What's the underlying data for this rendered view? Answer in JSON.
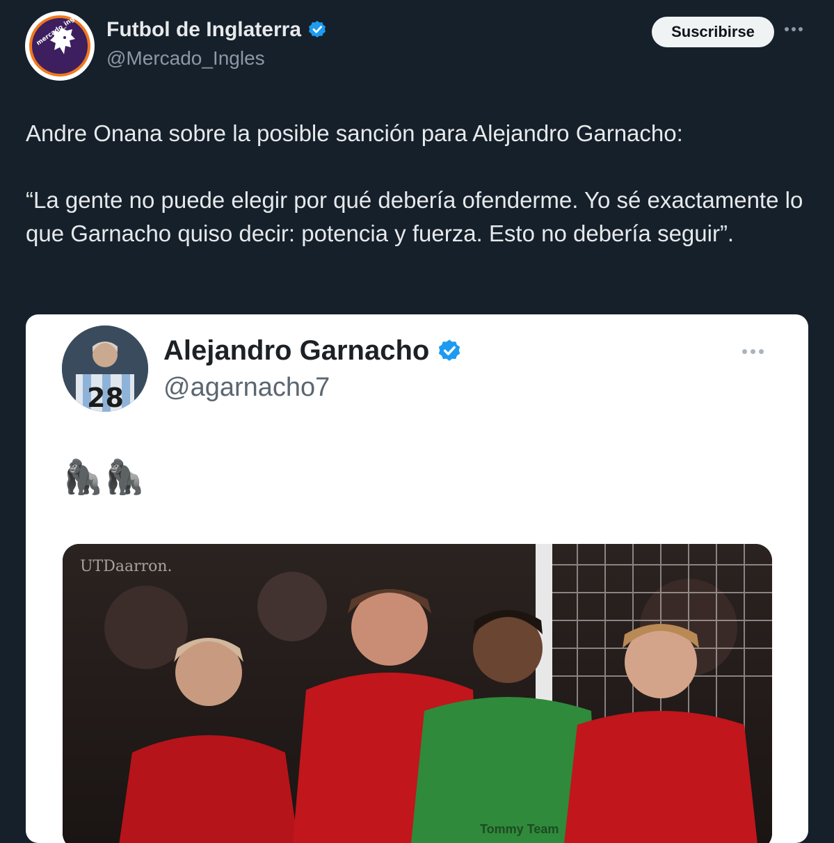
{
  "account": {
    "name": "Futbol de Inglaterra",
    "handle": "@Mercado_Ingles",
    "avatar_text": "mercado_ingles",
    "verified_icon": "verified-badge-icon",
    "subscribe_label": "Suscribirse",
    "more_icon": "more-dots-icon"
  },
  "tweet": {
    "line1": "Andre Onana sobre la posible sanción para Alejandro Garnacho:",
    "quote": "“La gente no puede elegir por qué debería ofenderme. Yo sé exactamente lo que Garnacho quiso decir: potencia y fuerza. Esto no debería seguir”."
  },
  "embedded": {
    "name": "Alejandro Garnacho",
    "handle": "@agarnacho7",
    "jersey_number": "28",
    "text": "🦍🦍",
    "photo_watermark": "UTDaarron.",
    "photo_shirt_text": "Tommy Team"
  },
  "colors": {
    "background": "#15202b",
    "text": "#e7e9ea",
    "secondary_text": "#8b98a5",
    "verified": "#1d9bf0",
    "button_bg": "#eff3f4",
    "card_bg": "#ffffff"
  }
}
